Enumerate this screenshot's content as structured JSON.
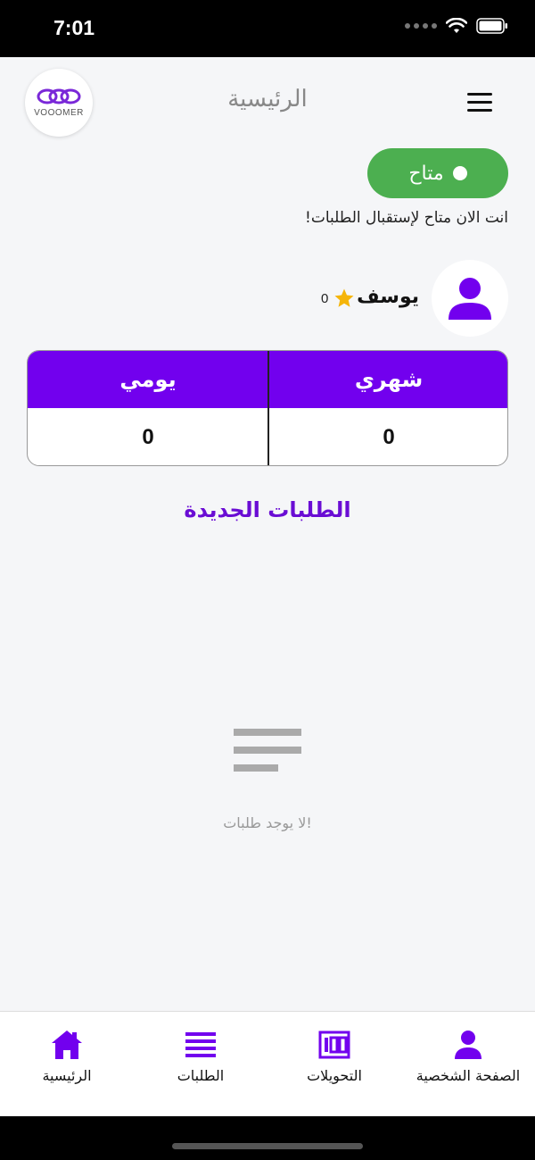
{
  "status_bar": {
    "time": "7:01"
  },
  "header": {
    "logo_text": "VOOOMER",
    "title": "الرئيسية"
  },
  "availability": {
    "toggle_label": "متاح",
    "message": "انت الان متاح لإستقبال الطلبات!"
  },
  "profile": {
    "name": "يوسف",
    "rating": "0"
  },
  "stats": {
    "headers": [
      "شهري",
      "يومي"
    ],
    "values": [
      "0",
      "0"
    ]
  },
  "orders": {
    "section_title": "الطلبات الجديدة",
    "empty_message": "لا يوجد طلبات!"
  },
  "bottom_nav": {
    "items": [
      {
        "label": "الصفحة الشخصية",
        "icon": "person-icon"
      },
      {
        "label": "التحويلات",
        "icon": "transfers-icon"
      },
      {
        "label": "الطلبات",
        "icon": "list-icon"
      },
      {
        "label": "الرئيسية",
        "icon": "home-icon"
      }
    ]
  },
  "colors": {
    "primary": "#7200ee",
    "available": "#4caf50",
    "star": "#f5b50a"
  }
}
